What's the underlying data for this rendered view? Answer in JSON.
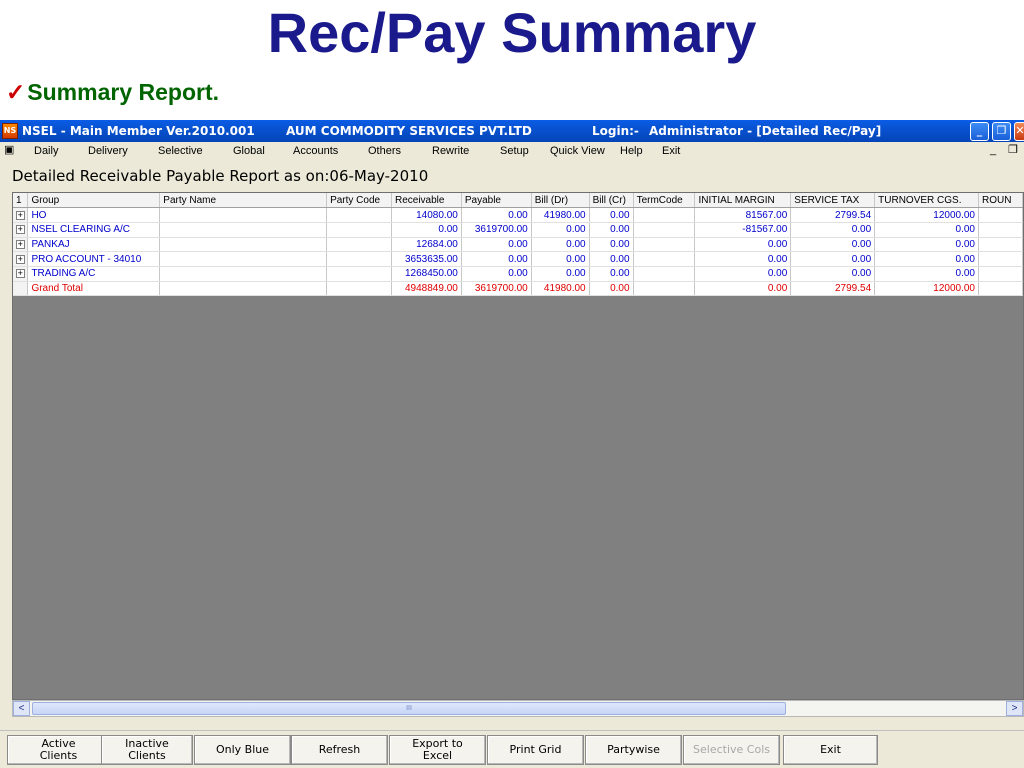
{
  "slide": {
    "title": "Rec/Pay Summary",
    "subtitle_check": "✓",
    "subtitle": "Summary Report."
  },
  "window": {
    "icon_text": "NS",
    "title_app": "NSEL - Main Member Ver.2010.001",
    "title_company": "AUM COMMODITY SERVICES PVT.LTD",
    "title_login_label": "Login:-",
    "title_login_value": "Administrator - [Detailed Rec/Pay]",
    "min_glyph": "_",
    "restore_glyph": "❐",
    "close_glyph": "✕"
  },
  "menu": {
    "items": [
      "Daily",
      "Delivery",
      "Selective",
      "Global",
      "Accounts",
      "Others",
      "Rewrite",
      "Setup",
      "Quick View",
      "Help",
      "Exit"
    ],
    "mdi_min": "_",
    "mdi_restore": "❐"
  },
  "report": {
    "title": "Detailed Receivable Payable Report as on:06-May-2010",
    "corner": "1",
    "columns": [
      "Group",
      "Party Name",
      "Party Code",
      "Receivable",
      "Payable",
      "Bill (Dr)",
      "Bill (Cr)",
      "TermCode",
      "INITIAL MARGIN",
      "SERVICE TAX",
      "TURNOVER CGS.",
      "ROUN"
    ],
    "expand_glyph": "+",
    "rows": [
      {
        "group": "HO",
        "party_name": "",
        "party_code": "",
        "receivable": "14080.00",
        "payable": "0.00",
        "bill_dr": "41980.00",
        "bill_cr": "0.00",
        "term_code": "",
        "initial_margin": "81567.00",
        "service_tax": "2799.54",
        "turnover_cgs": "12000.00"
      },
      {
        "group": "NSEL CLEARING A/C",
        "party_name": "",
        "party_code": "",
        "receivable": "0.00",
        "payable": "3619700.00",
        "bill_dr": "0.00",
        "bill_cr": "0.00",
        "term_code": "",
        "initial_margin": "-81567.00",
        "service_tax": "0.00",
        "turnover_cgs": "0.00"
      },
      {
        "group": "PANKAJ",
        "party_name": "",
        "party_code": "",
        "receivable": "12684.00",
        "payable": "0.00",
        "bill_dr": "0.00",
        "bill_cr": "0.00",
        "term_code": "",
        "initial_margin": "0.00",
        "service_tax": "0.00",
        "turnover_cgs": "0.00"
      },
      {
        "group": "PRO ACCOUNT - 34010",
        "party_name": "",
        "party_code": "",
        "receivable": "3653635.00",
        "payable": "0.00",
        "bill_dr": "0.00",
        "bill_cr": "0.00",
        "term_code": "",
        "initial_margin": "0.00",
        "service_tax": "0.00",
        "turnover_cgs": "0.00"
      },
      {
        "group": "TRADING A/C",
        "party_name": "",
        "party_code": "",
        "receivable": "1268450.00",
        "payable": "0.00",
        "bill_dr": "0.00",
        "bill_cr": "0.00",
        "term_code": "",
        "initial_margin": "0.00",
        "service_tax": "0.00",
        "turnover_cgs": "0.00"
      }
    ],
    "total": {
      "group": "Grand Total",
      "receivable": "4948849.00",
      "payable": "3619700.00",
      "bill_dr": "41980.00",
      "bill_cr": "0.00",
      "initial_margin": "0.00",
      "service_tax": "2799.54",
      "turnover_cgs": "12000.00"
    }
  },
  "scrollbar": {
    "left": "<",
    "right": ">",
    "grip": "III"
  },
  "buttons": {
    "active_line1": "Active",
    "active_line2": "Clients",
    "inactive_line1": "Inactive",
    "inactive_line2": "Clients",
    "only_blue": "Only Blue",
    "refresh": "Refresh",
    "export_line1": "Export to",
    "export_line2": "Excel",
    "print_grid": "Print Grid",
    "partywise": "Partywise",
    "selective_cols": "Selective Cols",
    "exit": "Exit"
  },
  "colors": {
    "slide_title": "#1a1a8c",
    "subtitle": "#006400",
    "check": "#cc0000",
    "grid_text": "#0000cc",
    "grand_total": "#e00000",
    "titlebar": "#0852d0",
    "grid_background": "#808080"
  }
}
